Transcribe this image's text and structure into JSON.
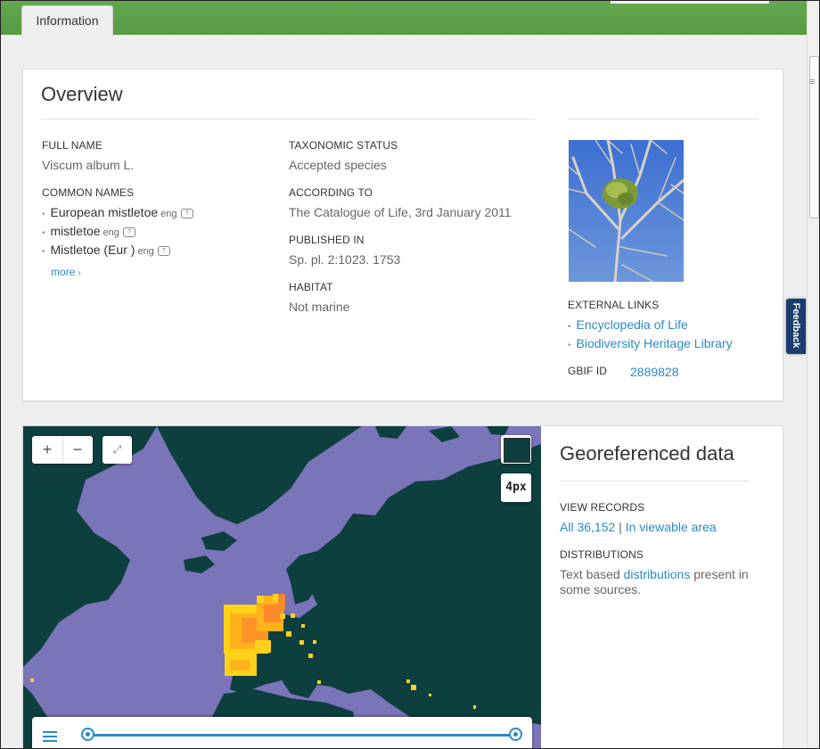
{
  "tabs": [
    {
      "label": "Information"
    }
  ],
  "overview": {
    "title": "Overview",
    "full_name_label": "FULL NAME",
    "full_name": "Viscum album L.",
    "common_names_label": "COMMON NAMES",
    "common_names": [
      {
        "name": "European mistletoe",
        "lang": "eng"
      },
      {
        "name": "mistletoe",
        "lang": "eng"
      },
      {
        "name": "Mistletoe (Eur )",
        "lang": "eng"
      }
    ],
    "more_label": "more",
    "taxonomic_status_label": "TAXONOMIC STATUS",
    "taxonomic_status": "Accepted species",
    "according_to_label": "ACCORDING TO",
    "according_to": "The Catalogue of Life, 3rd January 2011",
    "published_in_label": "PUBLISHED IN",
    "published_in": "Sp. pl. 2:1023. 1753",
    "habitat_label": "HABITAT",
    "habitat": "Not marine",
    "external_links_label": "EXTERNAL LINKS",
    "external_links": [
      "Encyclopedia of Life",
      "Biodiversity Heritage Library"
    ],
    "gbif_id_label": "GBIF ID",
    "gbif_id": "2889828"
  },
  "feedback_label": "Feedback",
  "map": {
    "zoom_in": "+",
    "zoom_out": "−",
    "pixel_size_label": "4px"
  },
  "georeferenced": {
    "title": "Georeferenced data",
    "view_records_label": "VIEW RECORDS",
    "all_records": "All 36,152",
    "separator": "|",
    "in_viewable_area": "In viewable area",
    "distributions_label": "DISTRIBUTIONS",
    "distributions_prefix": "Text based",
    "distributions_link": "distributions",
    "distributions_suffix": "present in some sources."
  },
  "colors": {
    "header_green": "#5ea24a",
    "link_blue": "#2a8ac9",
    "ocean": "#7a74b8",
    "land": "#0e3f3f",
    "feedback_bg": "#1b3d6d"
  }
}
